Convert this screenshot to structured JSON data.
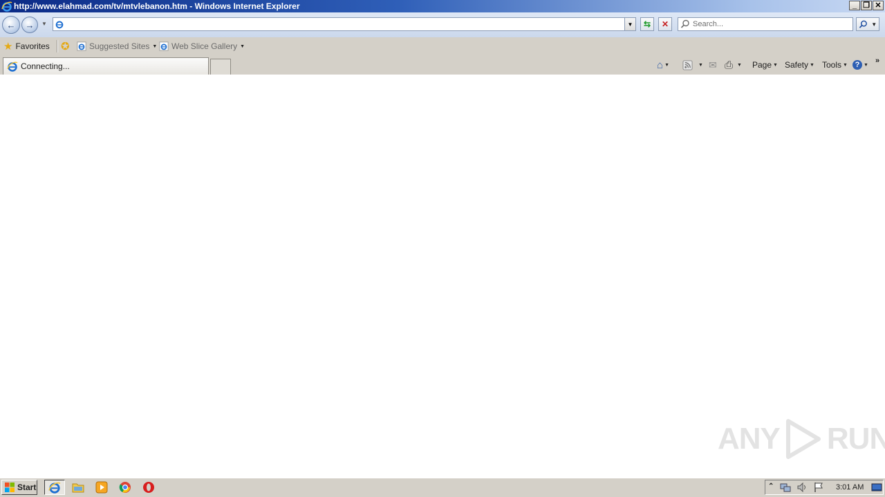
{
  "window": {
    "title": "http://www.elahmad.com/tv/mtvlebanon.htm - Windows Internet Explorer",
    "minimize": "_",
    "restore": "❐",
    "close": "✕"
  },
  "navigation": {
    "address_value": "",
    "search_placeholder": "Search..."
  },
  "favorites_bar": {
    "favorites_label": "Favorites",
    "suggested_sites": "Suggested Sites",
    "web_slice_gallery": "Web Slice Gallery"
  },
  "tabs": [
    {
      "label": "Connecting..."
    }
  ],
  "command_bar": {
    "page": "Page",
    "safety": "Safety",
    "tools": "Tools"
  },
  "watermark": {
    "text_left": "ANY",
    "text_right": "RUN"
  },
  "taskbar": {
    "start_label": "Start",
    "clock": "3:01 AM"
  },
  "colors": {
    "title_gradient_start": "#0b2a86",
    "chrome": "#d4d0c8",
    "ie_blue": "#1e6fd1"
  }
}
